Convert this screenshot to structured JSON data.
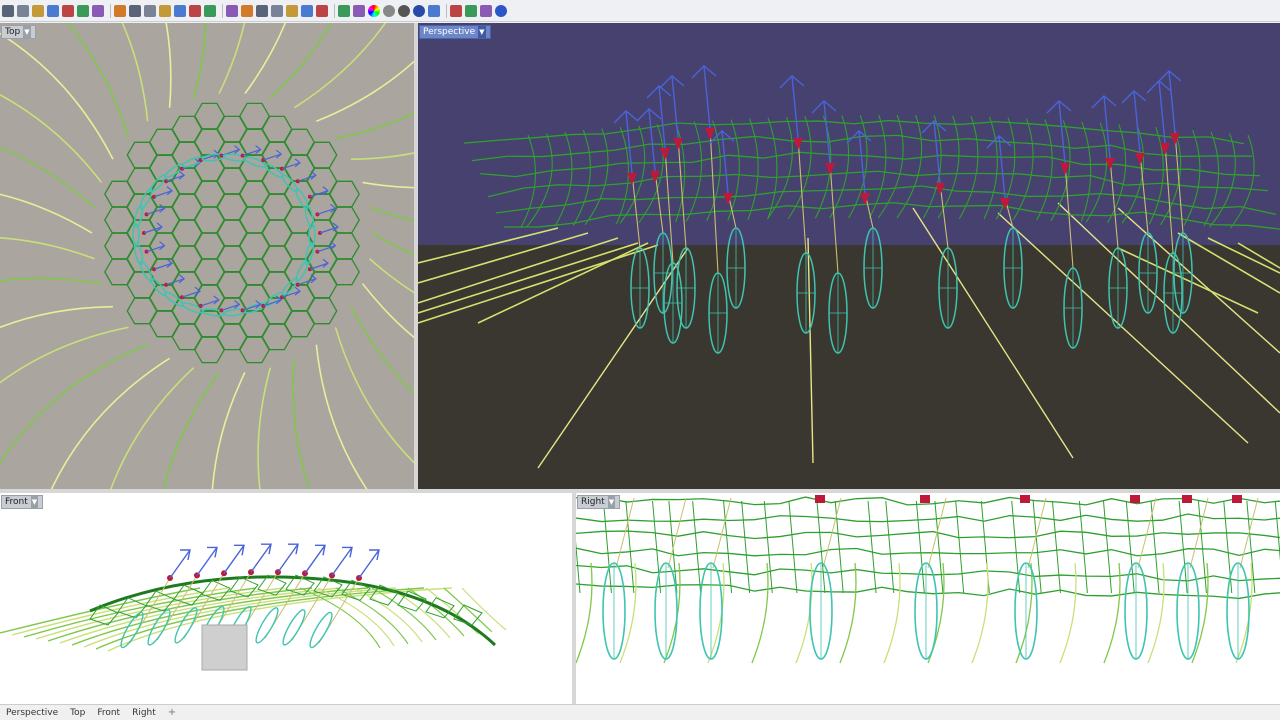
{
  "toolbar": {
    "icons": [
      "new-icon",
      "open-icon",
      "save-icon",
      "print-icon",
      "cut-icon",
      "copy-icon",
      "paste-icon",
      "undo-icon",
      "pan-icon",
      "rotate-icon",
      "zoom-in-icon",
      "zoom-out-icon",
      "zoom-window-icon",
      "zoom-extents-icon",
      "zoom-selected-icon",
      "grid-icon",
      "redraw-icon",
      "layer-icon",
      "car-icon",
      "cplane-icon",
      "light-icon",
      "lock-icon",
      "material-icon",
      "color-wheel-icon",
      "sphere-shaded-icon",
      "sphere-render-icon",
      "sphere-blue-icon",
      "ghost-icon",
      "sun-icon",
      "settings-icon",
      "globe-icon",
      "help-icon"
    ]
  },
  "viewports": {
    "top": {
      "label": "Top"
    },
    "perspective": {
      "label": "Perspective"
    },
    "front": {
      "label": "Front"
    },
    "right": {
      "label": "Right"
    }
  },
  "bottom_tabs": [
    "Perspective",
    "Top",
    "Front",
    "Right"
  ],
  "colors": {
    "mesh": "#2e8b2e",
    "curve": "#d8e880",
    "pod": "#3fc4b0",
    "arrow": "#4a63d8",
    "marker": "#c0183a",
    "top_bg": "#aaa59e",
    "persp_sky": "#46416e",
    "persp_ground": "#39372f"
  }
}
